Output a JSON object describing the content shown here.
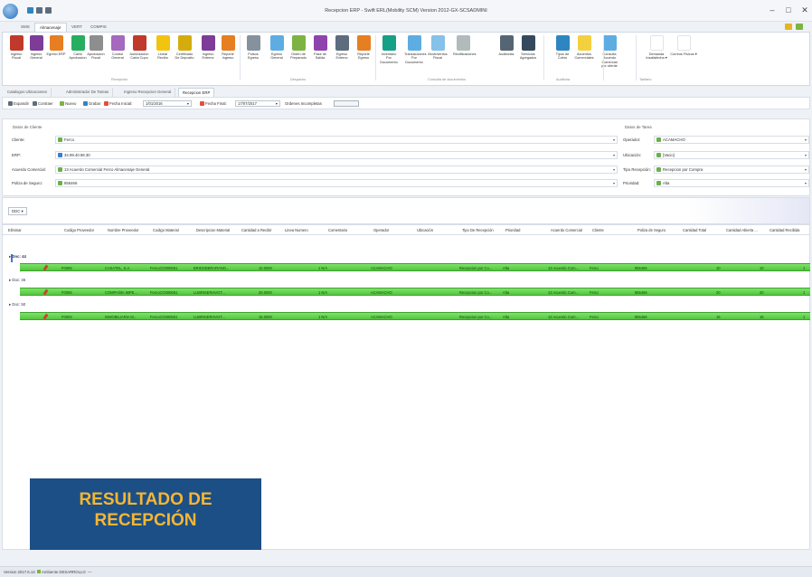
{
  "window": {
    "title": "Recepcion ERP - Swift ERL(Mobility SCM) Version 2012-GX-SCSADMINI",
    "minimize": "–",
    "maximize": "□",
    "close": "✕"
  },
  "menu_tabs": [
    "SMS",
    "Almacenaje",
    "VERT",
    "COMPIS"
  ],
  "ribbon": {
    "buttons": [
      {
        "label": "Ingreso Fiscal",
        "color": "#c0392b"
      },
      {
        "label": "Ingreso General",
        "color": "#7d3c98"
      },
      {
        "label": "Egreso ERP",
        "color": "#e67e22"
      },
      {
        "label": "Carta Aprobacion",
        "color": "#27ae60"
      },
      {
        "label": "Aprobacion Fiscal",
        "color": "#8e8e8e"
      },
      {
        "label": "Control General",
        "color": "#a569bd"
      },
      {
        "label": "Autorizacion Carta Cupo",
        "color": "#c0392b"
      },
      {
        "label": "Linear Recibo",
        "color": "#f1c40f"
      },
      {
        "label": "Certificado De Deposito",
        "color": "#d4ac0d"
      },
      {
        "label": "Ingreso Externo",
        "color": "#7d3c98"
      },
      {
        "label": "Reporte Ingreso",
        "color": "#e67e22"
      },
      {
        "label": "Pulsos Egreso",
        "color": "#85929e"
      },
      {
        "label": "Egreso General",
        "color": "#5dade2"
      },
      {
        "label": "Orden de Preparado",
        "color": "#7cb342"
      },
      {
        "label": "Pase de Salida",
        "color": "#8e44ad"
      },
      {
        "label": "Egreso Externo",
        "color": "#5d6d7e"
      },
      {
        "label": "Reporte Egreso",
        "color": "#e67e22"
      },
      {
        "label": "Inventario Por Documento",
        "color": "#16a085"
      },
      {
        "label": "Transacciones Por Documento",
        "color": "#5dade2"
      },
      {
        "label": "Movimientos Fiscal",
        "color": "#85c1e9"
      },
      {
        "label": "Rectificaciones",
        "color": "#b2babb"
      },
      {
        "label": "Auditorias",
        "color": "#566573"
      },
      {
        "label": "Servicios Agregados",
        "color": "#34495e"
      },
      {
        "label": "Tipos de Cobro",
        "color": "#2e86c1"
      },
      {
        "label": "Acuerdos Comerciales",
        "color": "#f4d03f"
      },
      {
        "label": "Consulta Acuerdo Comercial por cliente",
        "color": "#5dade2"
      },
      {
        "label": "Demanda Insatisfecha ▾",
        "color": "#ffffff"
      },
      {
        "label": "Correos Fisicos ▾",
        "color": "#ffffff"
      }
    ],
    "groups": [
      "Recepción",
      "Despacho",
      "Consulta de documentos",
      "Auditoria",
      "Tarifario"
    ]
  },
  "doc_tabs": [
    "Catalogos Ubicaciones",
    "Administrador De Tareas",
    "Ingreso Recepcion General",
    "Recepcion ERP"
  ],
  "toolbar": {
    "expand": "Expandir",
    "collapse": "Contraer",
    "new": "Nuevo",
    "save": "Grabar",
    "date_start_label": "Fecha Inicial:",
    "date_start": "1/01/2016",
    "date_end_label": "Fecha Final:",
    "date_end": "17/07/2017",
    "incomplete_label": "Ordenes Incompletas"
  },
  "client_form": {
    "section": "Datos de Cliente",
    "client_label": "Cliente:",
    "client_value": "Ferco",
    "erp_label": "ERP:",
    "erp_value": "34.99.40.98.30",
    "agreement_label": "Acuerdo Comercial:",
    "agreement_value": "13 Acuerdo Comercial Ferco Almacenaje General",
    "policy_label": "Poliza de Seguro:",
    "policy_value": "855466"
  },
  "task_form": {
    "section": "Datos de Tarea",
    "operator_label": "Operador:",
    "operator_value": "ACAMACHO",
    "location_label": "Ubicación:",
    "location_value": "[Vacio]",
    "reception_type_label": "Tipo Recepción:",
    "reception_type_value": "Recepcion por Compra",
    "priority_label": "Prioridad:",
    "priority_value": "Alta"
  },
  "grid": {
    "ddc_button": "DDC ▾",
    "columns": [
      "Eliminar",
      "Codigo Proveedor",
      "Nombre Proveedor",
      "Codigo Material",
      "Descripcion Material",
      "Cantidad a Recibir",
      "Linea Numero",
      "Comentario",
      "Operador",
      "Ubicación",
      "Tipo De Recepción",
      "Prioridad",
      "Acuerdo Comercial",
      "Cliente",
      "Poliza de Seguro",
      "Cantidad Total",
      "Cantidad Abierta ...",
      "Cantidad Recibida"
    ],
    "groups": [
      {
        "label": "Doc: 44",
        "row": {
          "supplier_code": "F0005",
          "supplier_name": "CASATEL, S.A.",
          "material_code": "FercoCO000651",
          "material_desc": "BRIDOBERARANO...",
          "qty": "10.0000",
          "line": "1 N/A",
          "operator": "ACAMACHO",
          "type": "Recepcion por Co...",
          "priority": "Alta",
          "agreement": "13 Acuerdo Com...",
          "client": "Ferco",
          "policy": "855466",
          "total": "10",
          "open": "10",
          "received": "1"
        }
      },
      {
        "label": "Doc: 46",
        "row": {
          "supplier_code": "F0006",
          "supplier_name": "COMPAÑÍA IMPE...",
          "material_code": "FercoCO000651",
          "material_desc": "LUBRISERHVGT...",
          "qty": "20.0000",
          "line": "1 N/A",
          "operator": "ACAMACHO",
          "type": "Recepcion por Co...",
          "priority": "Alta",
          "agreement": "13 Acuerdo Com...",
          "client": "Ferco",
          "policy": "855466",
          "total": "20",
          "open": "20",
          "received": "1"
        }
      },
      {
        "label": "Doc: 50",
        "row": {
          "supplier_code": "F0003",
          "supplier_name": "INMOBILIARIA M...",
          "material_code": "FercoCO000651",
          "material_desc": "LUBRISERHVGT...",
          "qty": "15.0000",
          "line": "1 N/A",
          "operator": "ACAMACHO",
          "type": "Recepcion por Co...",
          "priority": "Alta",
          "agreement": "13 Acuerdo Com...",
          "client": "Ferco",
          "policy": "855466",
          "total": "15",
          "open": "15",
          "received": "1"
        }
      }
    ]
  },
  "banner": {
    "line1": "RESULTADO DE",
    "line2": "RECEPCIÓN"
  },
  "status": {
    "version": "Version 2017.6.13",
    "user": "Ambiente DESARROLLO",
    "extra": "—"
  }
}
